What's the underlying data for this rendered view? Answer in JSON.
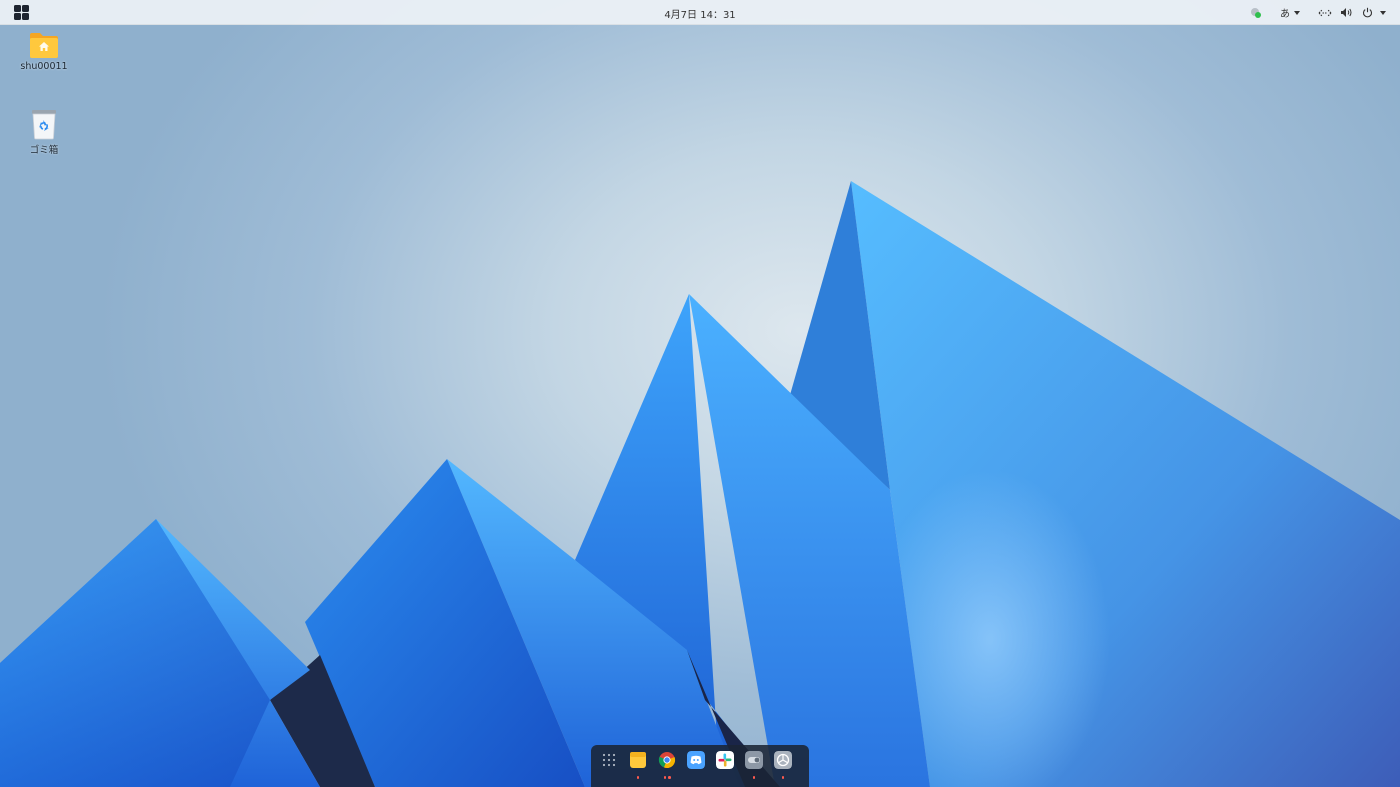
{
  "topbar": {
    "clock": "4月7日 14：31",
    "input_method": "あ"
  },
  "desktop": {
    "icons": [
      {
        "label": "shu00011",
        "icon": "home-folder-icon"
      },
      {
        "label": "ゴミ箱",
        "icon": "trash-icon"
      }
    ]
  },
  "dock": {
    "items": [
      {
        "name": "app-launcher",
        "icon": "grid-dots-icon",
        "running_dots": 0
      },
      {
        "name": "files",
        "icon": "folder-icon",
        "running_dots": 1
      },
      {
        "name": "chrome",
        "icon": "chrome-icon",
        "running_dots": 2
      },
      {
        "name": "discord",
        "icon": "discord-icon",
        "running_dots": 0
      },
      {
        "name": "slack",
        "icon": "slack-icon",
        "running_dots": 0
      },
      {
        "name": "settings",
        "icon": "settings-toggle-icon",
        "running_dots": 1
      },
      {
        "name": "system-monitor",
        "icon": "monitor-icon",
        "running_dots": 1
      }
    ]
  },
  "colors": {
    "accent": "#2d8cf0",
    "running_indicator": "#ff5a4e",
    "dock_bg": "#1a2434"
  }
}
